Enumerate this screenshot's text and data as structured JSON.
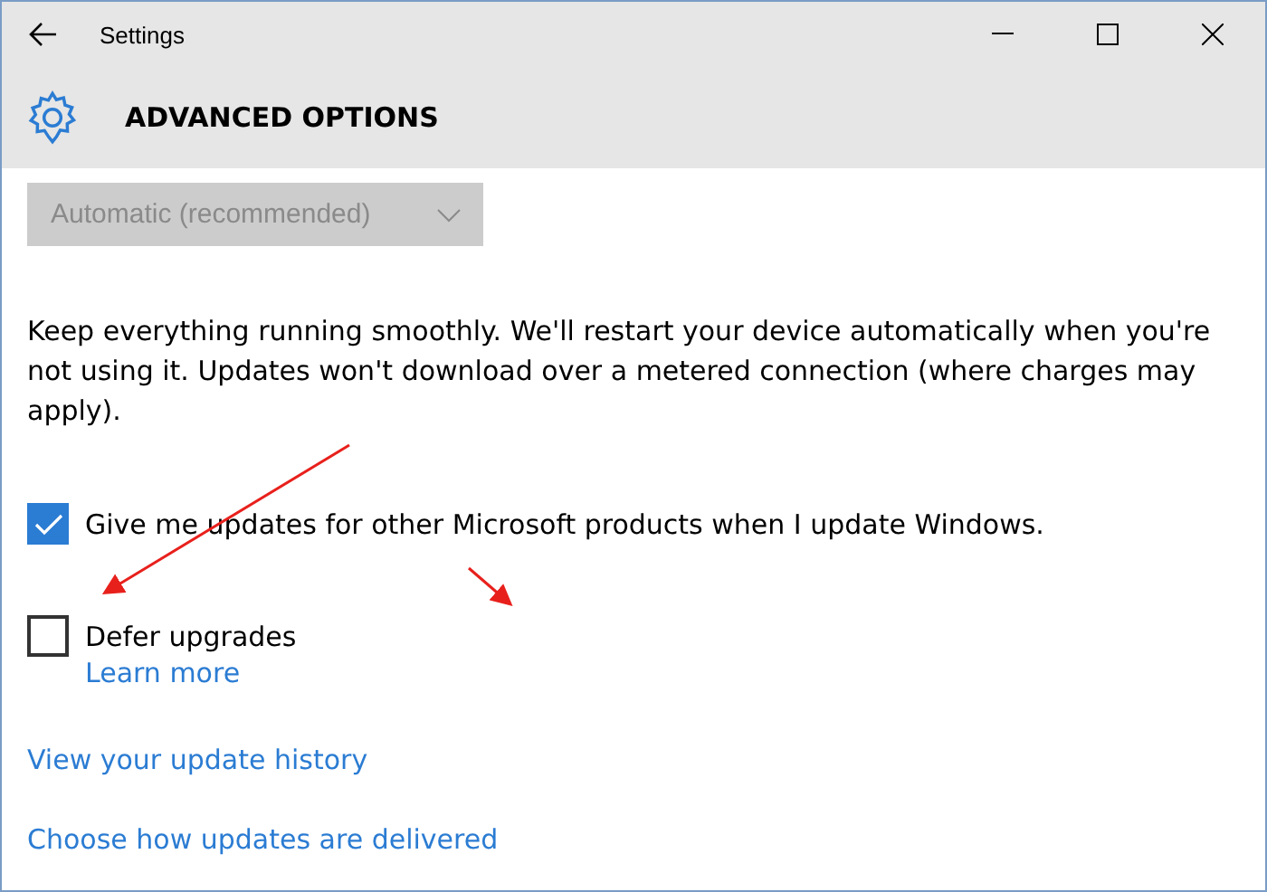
{
  "window": {
    "title": "Settings"
  },
  "header": {
    "title": "ADVANCED OPTIONS"
  },
  "dropdown": {
    "value": "Automatic (recommended)",
    "disabled": true
  },
  "description": "Keep everything running smoothly. We'll restart your device automatically when you're not using it. Updates won't download over a metered connection (where charges may apply).",
  "options": [
    {
      "label": "Give me updates for other Microsoft products when I update Windows.",
      "checked": true
    },
    {
      "label": "Defer upgrades",
      "checked": false,
      "link": "Learn more"
    }
  ],
  "links": [
    "View your update history",
    "Choose how updates are delivered"
  ]
}
